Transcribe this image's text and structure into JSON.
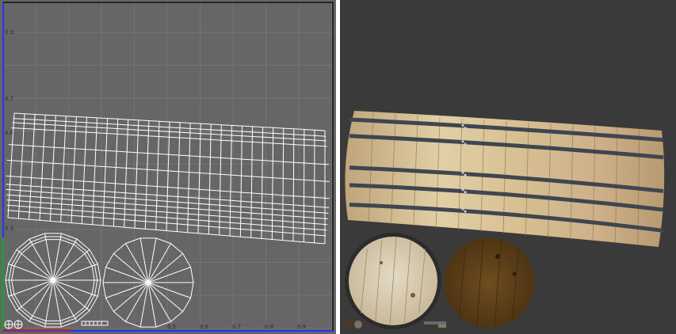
{
  "uv_editor": {
    "y_ticks": [
      "0.9",
      "0.7",
      "0.6",
      "0.3"
    ],
    "x_ticks": [
      "0.5",
      "0.6",
      "0.7",
      "0.8",
      "0.9"
    ],
    "colors": {
      "background": "#666666",
      "grid": "#747474",
      "wire": "#ffffff",
      "v_axis": "#2233ff",
      "u_axis": "#d02020",
      "origin_axis": "#00b020"
    }
  },
  "texture_preview": {
    "colors": {
      "background": "#3a3a3a",
      "wood": "#d9c39c",
      "band": "#3e4650",
      "lid_wood": "#dcd0b6",
      "lid_dark": "#5a3e18"
    }
  }
}
